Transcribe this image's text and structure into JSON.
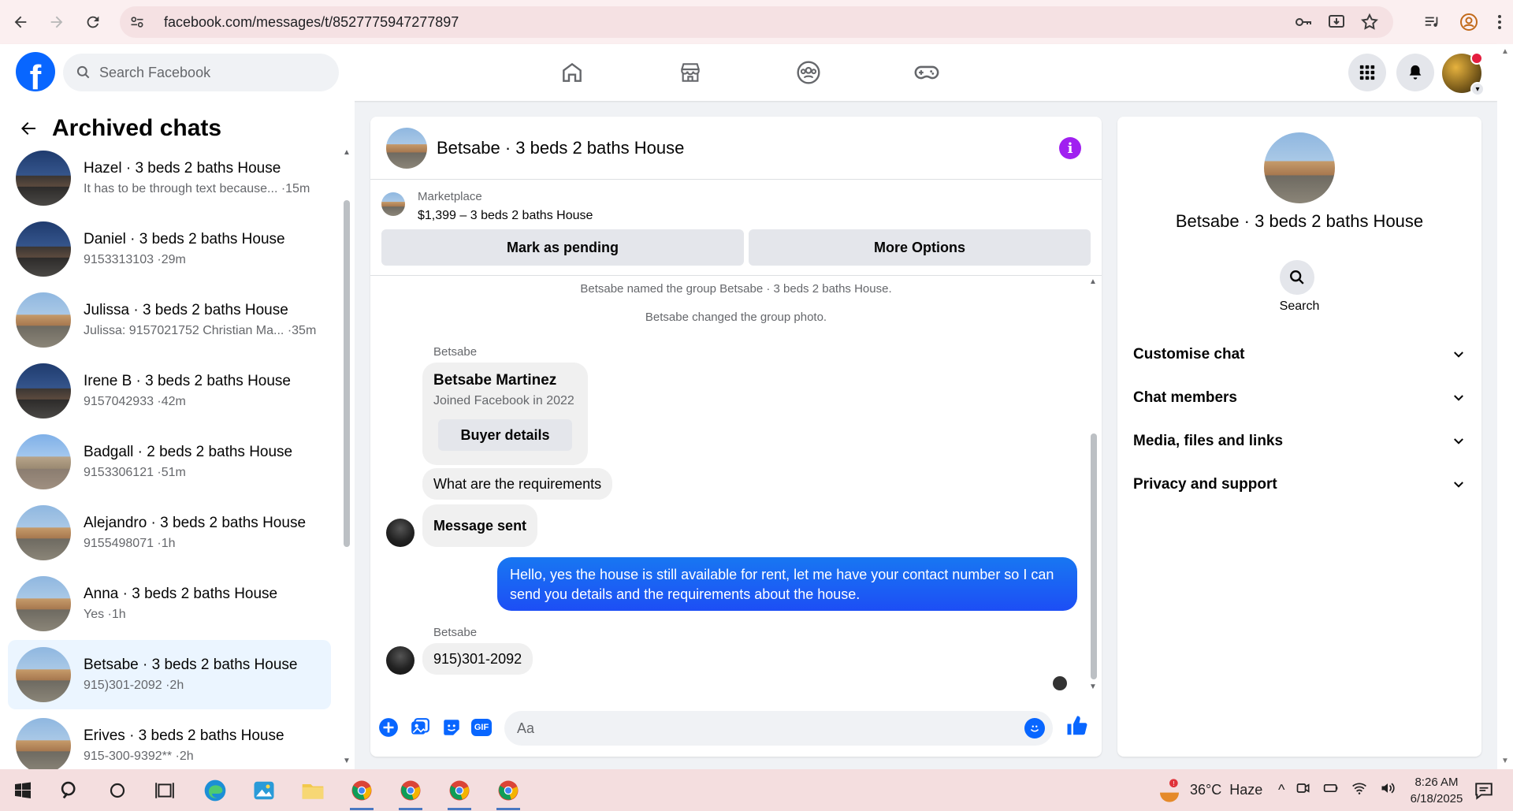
{
  "browser": {
    "url": "facebook.com/messages/t/8527775947277897"
  },
  "facebook": {
    "search_placeholder": "Search Facebook"
  },
  "left_panel": {
    "title": "Archived chats",
    "chats": [
      {
        "name": "Hazel · 3 beds 2 baths House",
        "preview": "It has to be through text because... ·15m",
        "thumb": "night",
        "active": false
      },
      {
        "name": "Daniel · 3 beds 2 baths House",
        "preview": "9153313103 ·29m",
        "thumb": "night",
        "active": false
      },
      {
        "name": "Julissa · 3 beds 2 baths House",
        "preview": "Julissa: 9157021752 Christian Ma... ·35m",
        "thumb": "day",
        "active": false
      },
      {
        "name": "Irene B · 3 beds 2 baths House",
        "preview": "9157042933 ·42m",
        "thumb": "night",
        "active": false
      },
      {
        "name": "Badgall · 2 beds 2 baths House",
        "preview": "9153306121 ·51m",
        "thumb": "blue",
        "active": false
      },
      {
        "name": "Alejandro · 3 beds 2 baths House",
        "preview": "9155498071 ·1h",
        "thumb": "day",
        "active": false
      },
      {
        "name": "Anna · 3 beds 2 baths House",
        "preview": "Yes ·1h",
        "thumb": "day",
        "active": false
      },
      {
        "name": "Betsabe · 3 beds 2 baths House",
        "preview": "915)301-2092 ·2h",
        "thumb": "day",
        "active": true
      },
      {
        "name": "Erives · 3 beds 2 baths House",
        "preview": "915-300-9392** ·2h",
        "thumb": "day",
        "active": false
      }
    ]
  },
  "conversation": {
    "title": "Betsabe · 3 beds 2 baths House",
    "marketplace": {
      "label": "Marketplace",
      "item": "$1,399 – 3 beds 2 baths House",
      "pending_button": "Mark as pending",
      "options_button": "More Options"
    },
    "system_messages": [
      "Betsabe named the group Betsabe · 3 beds 2 baths House.",
      "Betsabe changed the group photo."
    ],
    "sender_label": "Betsabe",
    "card": {
      "name": "Betsabe Martinez",
      "joined": "Joined Facebook in 2022",
      "button": "Buyer details"
    },
    "messages": {
      "requirements": "What are the requirements",
      "sent": "Message sent",
      "outgoing": "Hello, yes the house is still available for rent, let me have your contact number so I can send you details and the requirements about the house.",
      "reply": "915)301-2092"
    },
    "composer_placeholder": "Aa",
    "composer_tools": [
      "plus-icon",
      "photo-icon",
      "sticker-icon",
      "gif-icon"
    ],
    "gif_label": "GIF"
  },
  "info_panel": {
    "name": "Betsabe · 3 beds 2 baths House",
    "search_label": "Search",
    "sections": [
      "Customise chat",
      "Chat members",
      "Media, files and links",
      "Privacy and support"
    ]
  },
  "taskbar": {
    "weather": "36°C  Haze",
    "time": "8:26 AM",
    "date": "6/18/2025"
  },
  "colors": {
    "fb_blue": "#0866ff",
    "outgoing_bubble": "#1d4ef5",
    "info_icon": "#a020f0",
    "active_chat": "#ebf5ff"
  }
}
